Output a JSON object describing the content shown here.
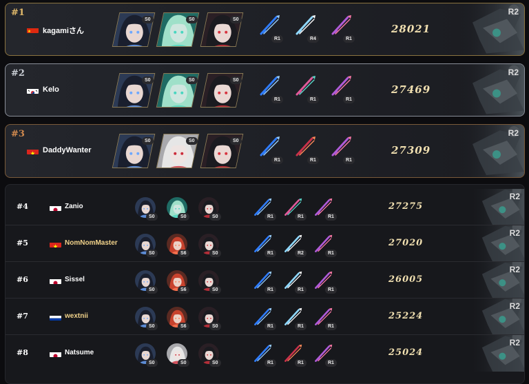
{
  "top": [
    {
      "rank": "#1",
      "player": "kagamiさん",
      "flag": "cn",
      "rank_color": "#e0b96a",
      "border": "gold",
      "chars": [
        {
          "tone": "dark",
          "badge": "S0"
        },
        {
          "tone": "teal",
          "badge": "S0"
        },
        {
          "tone": "redblack",
          "badge": "S0"
        }
      ],
      "weapons": [
        {
          "kind": "blue",
          "badge": "R1"
        },
        {
          "kind": "cyan",
          "badge": "R4"
        },
        {
          "kind": "purple",
          "badge": "R1"
        }
      ],
      "score": "28021",
      "r": "R2"
    },
    {
      "rank": "#2",
      "player": "Kelo",
      "flag": "kr",
      "rank_color": "#c8ccd3",
      "border": "silver",
      "chars": [
        {
          "tone": "dark",
          "badge": "S0"
        },
        {
          "tone": "teal",
          "badge": "S0"
        },
        {
          "tone": "redblack",
          "badge": "S0"
        }
      ],
      "weapons": [
        {
          "kind": "blue",
          "badge": "R1"
        },
        {
          "kind": "pinkteal",
          "badge": "R1"
        },
        {
          "kind": "purple",
          "badge": "R1"
        }
      ],
      "score": "27469",
      "r": "R2"
    },
    {
      "rank": "#3",
      "player": "DaddyWanter",
      "flag": "vn",
      "rank_color": "#d28a4e",
      "border": "bronze",
      "chars": [
        {
          "tone": "dark",
          "badge": "S0"
        },
        {
          "tone": "white",
          "badge": "S0"
        },
        {
          "tone": "redblack",
          "badge": "S0"
        }
      ],
      "weapons": [
        {
          "kind": "blue",
          "badge": "R1"
        },
        {
          "kind": "red",
          "badge": "R1"
        },
        {
          "kind": "purple",
          "badge": "R1"
        }
      ],
      "score": "27309",
      "r": "R2"
    }
  ],
  "rows": [
    {
      "rank": "#4",
      "player": "Zanio",
      "flag": "jp",
      "name_color": "#ffffff",
      "chars": [
        {
          "tone": "dark",
          "badge": "S0"
        },
        {
          "tone": "teal",
          "badge": "S0"
        },
        {
          "tone": "redblack",
          "badge": "S0"
        }
      ],
      "weapons": [
        {
          "kind": "blue",
          "badge": "R1"
        },
        {
          "kind": "pinkteal",
          "badge": "R1"
        },
        {
          "kind": "purple",
          "badge": "R1"
        }
      ],
      "score": "27275",
      "r": "R2"
    },
    {
      "rank": "#5",
      "player": "NomNomMaster",
      "flag": "vn",
      "name_color": "#f1d28a",
      "chars": [
        {
          "tone": "dark",
          "badge": "S0"
        },
        {
          "tone": "red",
          "badge": "S6"
        },
        {
          "tone": "redblack",
          "badge": "S0"
        }
      ],
      "weapons": [
        {
          "kind": "blue",
          "badge": "R1"
        },
        {
          "kind": "cyan",
          "badge": "R2"
        },
        {
          "kind": "purple",
          "badge": "R1"
        }
      ],
      "score": "27020",
      "r": "R2"
    },
    {
      "rank": "#6",
      "player": "Sissel",
      "flag": "jp",
      "name_color": "#ffffff",
      "chars": [
        {
          "tone": "dark",
          "badge": "S0"
        },
        {
          "tone": "red",
          "badge": "S6"
        },
        {
          "tone": "redblack",
          "badge": "S0"
        }
      ],
      "weapons": [
        {
          "kind": "blue",
          "badge": "R1"
        },
        {
          "kind": "cyan",
          "badge": "R1"
        },
        {
          "kind": "purple",
          "badge": "R1"
        }
      ],
      "score": "26005",
      "r": "R2"
    },
    {
      "rank": "#7",
      "player": "wextnii",
      "flag": "ru",
      "name_color": "#f1d28a",
      "chars": [
        {
          "tone": "dark",
          "badge": "S0"
        },
        {
          "tone": "red",
          "badge": "S6"
        },
        {
          "tone": "redblack",
          "badge": "S0"
        }
      ],
      "weapons": [
        {
          "kind": "blue",
          "badge": "R1"
        },
        {
          "kind": "cyan",
          "badge": "R1"
        },
        {
          "kind": "purple",
          "badge": "R1"
        }
      ],
      "score": "25224",
      "r": "R2"
    },
    {
      "rank": "#8",
      "player": "Natsume",
      "flag": "jp",
      "name_color": "#ffffff",
      "chars": [
        {
          "tone": "dark",
          "badge": "S0"
        },
        {
          "tone": "white",
          "badge": "S0"
        },
        {
          "tone": "redblack",
          "badge": "S0"
        }
      ],
      "weapons": [
        {
          "kind": "blue",
          "badge": "R1"
        },
        {
          "kind": "red",
          "badge": "R1"
        },
        {
          "kind": "purple",
          "badge": "R1"
        }
      ],
      "score": "25024",
      "r": "R2"
    }
  ]
}
